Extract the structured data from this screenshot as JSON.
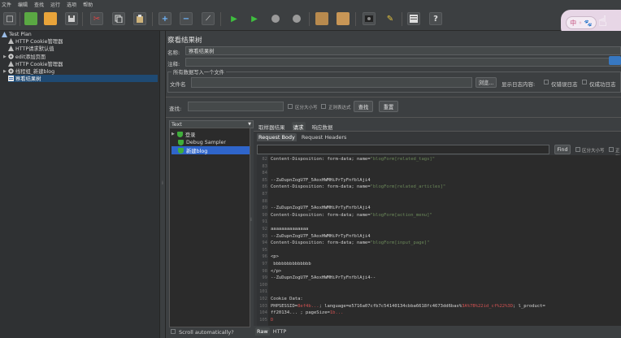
{
  "menu": [
    "文件",
    "编辑",
    "查找",
    "运行",
    "选项",
    "帮助"
  ],
  "toolbar": {
    "icons": [
      "new-icon",
      "templates-icon",
      "open-icon",
      "save-icon",
      "cut-icon",
      "copy-icon",
      "paste-icon",
      "expand-icon",
      "collapse-icon",
      "toggle-icon",
      "start-icon",
      "start-no-pause-icon",
      "stop-icon",
      "shutdown-icon",
      "clear-icon",
      "clear-all-icon",
      "search-icon",
      "reset-search-icon",
      "function-helper-icon",
      "help-icon"
    ]
  },
  "tree": [
    {
      "label": "Test Plan",
      "indent": 0,
      "icon": "testplan"
    },
    {
      "label": "HTTP Cookie管理器",
      "indent": 1,
      "icon": "config"
    },
    {
      "label": "HTTP请求默认值",
      "indent": 1,
      "icon": "config"
    },
    {
      "label": "edit添加页面",
      "indent": 1,
      "icon": "threadgroup"
    },
    {
      "label": "HTTP Cookie管理器",
      "indent": 1,
      "icon": "config"
    },
    {
      "label": "线程组_新建blog",
      "indent": 1,
      "icon": "threadgroup"
    },
    {
      "label": "察看结果树",
      "indent": 1,
      "icon": "listener",
      "selected": true
    }
  ],
  "panel": {
    "title": "察看结果树",
    "name_label": "名称:",
    "name_value": "察看结果树",
    "comment_label": "注释:",
    "group_title": "所有数据写入一个文件",
    "file_label": "文件名",
    "browse_btn": "浏览...",
    "log_label": "显示日志内容:",
    "errors_only": "仅错误日志",
    "success_only": "仅成功日志",
    "configure_btn": "Configure",
    "search_label": "查找:",
    "case_label": "区分大小写",
    "regex_label": "正则表达式",
    "search_btn": "查找",
    "reset_btn": "重置"
  },
  "sampler": {
    "renderer": "Text",
    "items": [
      {
        "label": "登录",
        "selected": false
      },
      {
        "label": "Debug Sampler",
        "selected": false
      },
      {
        "label": "新建blog",
        "selected": true
      }
    ],
    "scroll_auto": "Scroll automatically?"
  },
  "result_tabs": [
    "取样器结果",
    "请求",
    "响应数据"
  ],
  "result_tab_active": 1,
  "sub_tabs": [
    "Request Body",
    "Request Headers"
  ],
  "sub_tab_active": 0,
  "find_btn": "Find",
  "find_case": "区分大小写",
  "find_regex": "正则表达式",
  "code_lines": [
    {
      "n": "82",
      "parts": [
        [
          "txt",
          "Content-Disposition: form-data; name="
        ],
        [
          "str",
          "\"blogForm[related_tags]\""
        ]
      ]
    },
    {
      "n": "83",
      "parts": []
    },
    {
      "n": "84",
      "parts": []
    },
    {
      "n": "85",
      "parts": [
        [
          "txt",
          "--ZuDupnZogU7F_5AoxHWMHiPrTyFnfblAji4"
        ]
      ]
    },
    {
      "n": "86",
      "parts": [
        [
          "txt",
          "Content-Disposition: form-data; name="
        ],
        [
          "str",
          "\"blogForm[related_articles]\""
        ]
      ]
    },
    {
      "n": "87",
      "parts": []
    },
    {
      "n": "88",
      "parts": []
    },
    {
      "n": "89",
      "parts": [
        [
          "txt",
          "--ZuDupnZogU7F_5AoxHWMHiPrTyFnfblAji4"
        ]
      ]
    },
    {
      "n": "90",
      "parts": [
        [
          "txt",
          "Content-Disposition: form-data; name="
        ],
        [
          "str",
          "\"blogForm[action_menu]\""
        ]
      ]
    },
    {
      "n": "91",
      "parts": []
    },
    {
      "n": "92",
      "parts": [
        [
          "txt",
          "aaaaaaaaaaaaaa"
        ]
      ]
    },
    {
      "n": "93",
      "parts": [
        [
          "txt",
          "--ZuDupnZogU7F_5AoxHWMHiPrTyFnfblAji4"
        ]
      ]
    },
    {
      "n": "94",
      "parts": [
        [
          "txt",
          "Content-Disposition: form-data; name="
        ],
        [
          "str",
          "\"blogForm[input_page]\""
        ]
      ]
    },
    {
      "n": "95",
      "parts": []
    },
    {
      "n": "96",
      "parts": [
        [
          "txt",
          "<p>"
        ]
      ]
    },
    {
      "n": "97",
      "parts": [
        [
          "txt",
          "    bbbbbbbbbbbbbb"
        ]
      ]
    },
    {
      "n": "98",
      "parts": [
        [
          "txt",
          "</p>"
        ]
      ]
    },
    {
      "n": "99",
      "parts": [
        [
          "txt",
          "--ZuDupnZogU7F_5AoxHWMHiPrTyFnfblAji4--"
        ]
      ]
    },
    {
      "n": "100",
      "parts": []
    },
    {
      "n": "101",
      "parts": []
    },
    {
      "n": "102",
      "parts": [
        [
          "txt",
          "Cookie Data:"
        ]
      ]
    },
    {
      "n": "103",
      "parts": [
        [
          "txt",
          "PHPSESSID="
        ],
        [
          "hl",
          "8ef4b..."
        ],
        [
          "txt",
          "; language=e5716a07cfb7c54140134cbba6618fc4673dd6bas%"
        ],
        [
          "hl",
          "3A%7B%22id_cf%22%3D"
        ],
        [
          "txt",
          "; l_product="
        ]
      ]
    },
    {
      "n": "104",
      "parts": [
        [
          "txt",
          "ff20134... ; pageSize="
        ],
        [
          "hl",
          "1b..."
        ]
      ]
    },
    {
      "n": "105",
      "parts": [
        [
          "hl",
          "D"
        ]
      ]
    }
  ],
  "bottom_tabs": [
    "Raw",
    "HTTP"
  ],
  "bottom_tab_active": 0,
  "decor_text": "中 ◦ 🐾"
}
